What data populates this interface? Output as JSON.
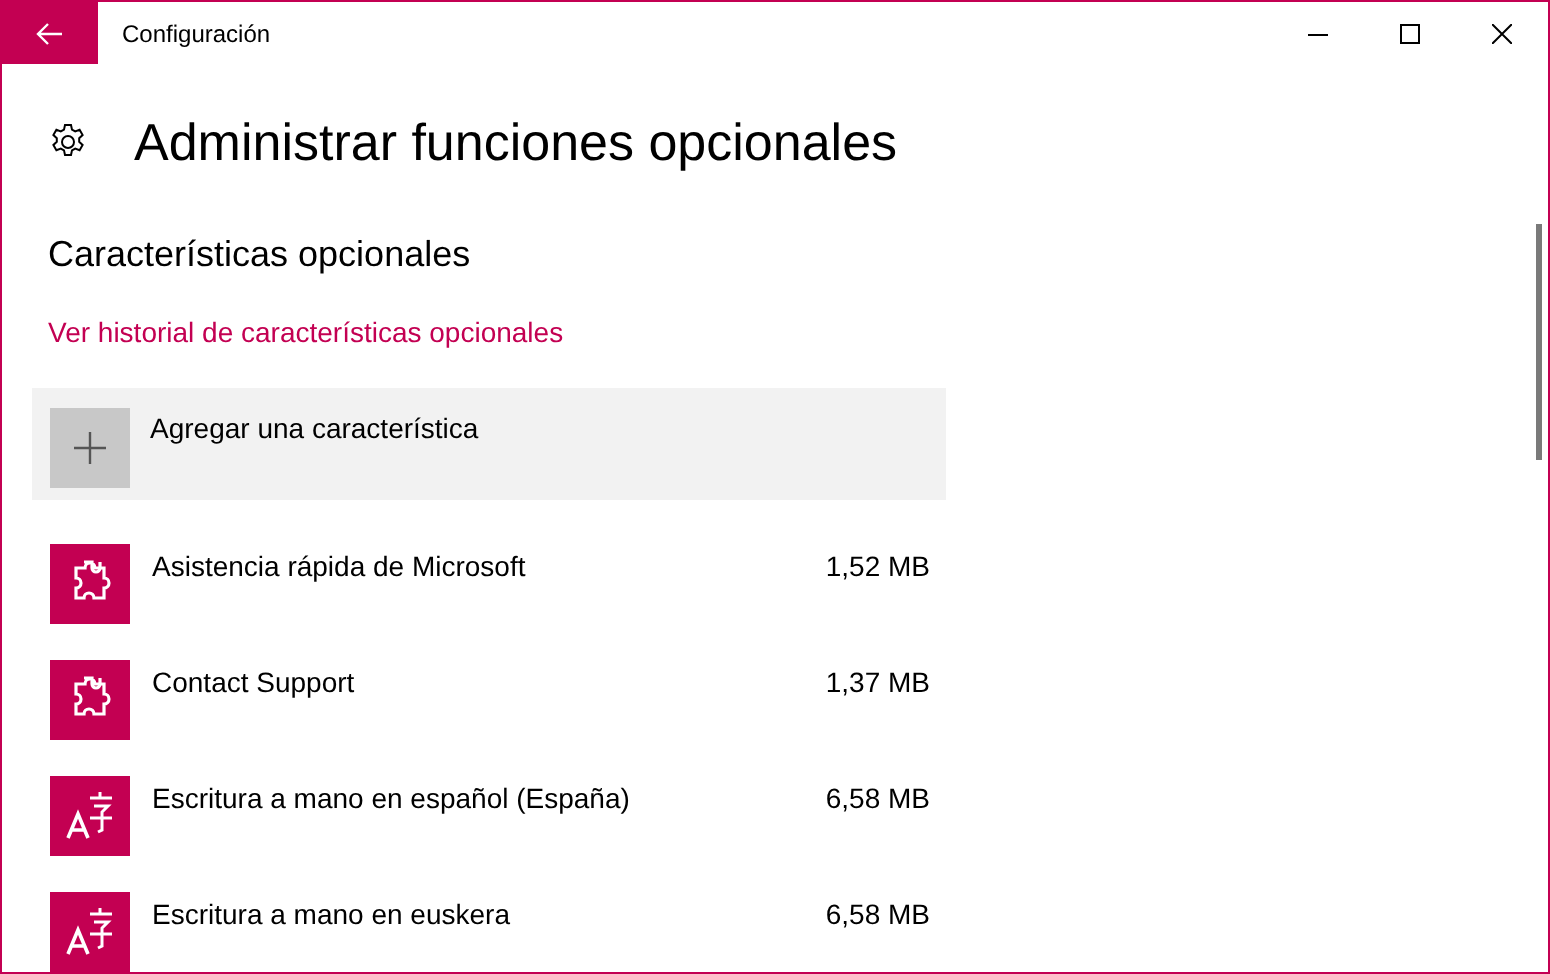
{
  "window": {
    "title": "Configuración"
  },
  "page": {
    "title": "Administrar funciones opcionales"
  },
  "section": {
    "title": "Características opcionales",
    "link": "Ver historial de características opcionales",
    "add_button": "Agregar una característica"
  },
  "features": [
    {
      "kind": "puzzle",
      "name": "Asistencia rápida de Microsoft",
      "size": "1,52 MB"
    },
    {
      "kind": "puzzle",
      "name": "Contact Support",
      "size": "1,37 MB"
    },
    {
      "kind": "language",
      "name": "Escritura a mano en español (España)",
      "size": "6,58 MB"
    },
    {
      "kind": "language",
      "name": "Escritura a mano en euskera",
      "size": "6,58 MB"
    }
  ]
}
